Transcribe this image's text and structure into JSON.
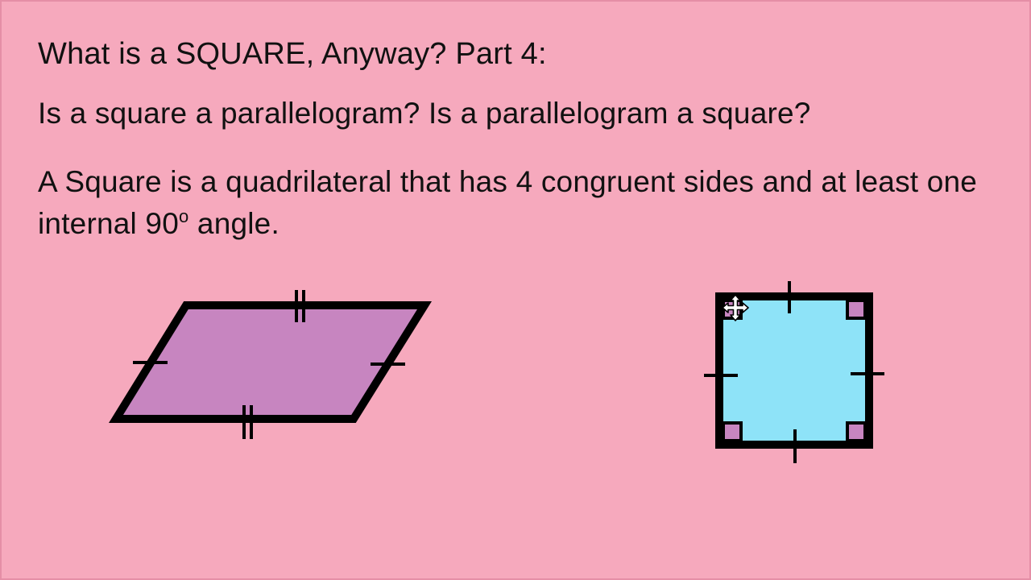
{
  "slide": {
    "title": "What is a SQUARE, Anyway? Part 4:",
    "question": "Is a square a parallelogram? Is a parallelogram a square?",
    "definition_before": "A Square is a quadrilateral that has 4 congruent sides and at least one internal 90",
    "definition_degree": "o",
    "definition_after": " angle."
  },
  "colors": {
    "background": "#f6a9bd",
    "parallelogram_fill": "#c785c0",
    "square_fill": "#8ee3f8",
    "right_angle_marker": "#c785c0",
    "stroke": "#000000"
  },
  "icons": {
    "cursor": "move-cursor-icon"
  }
}
